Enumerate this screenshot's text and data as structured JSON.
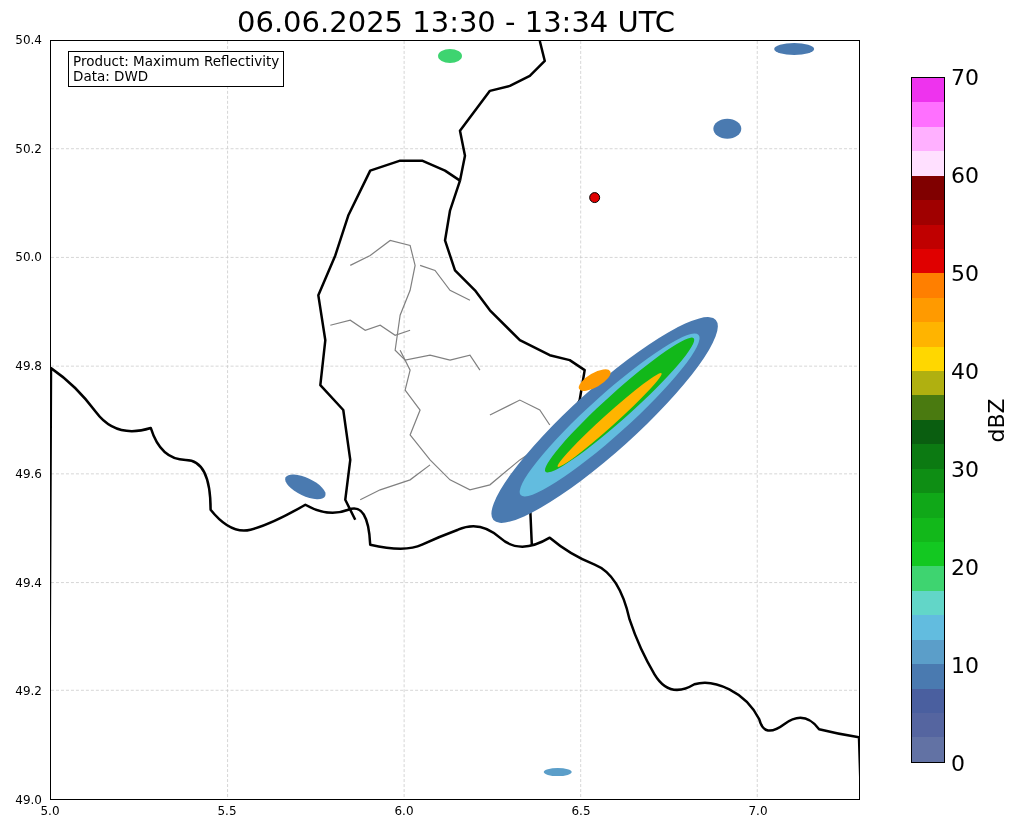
{
  "title": "06.06.2025 13:30 - 13:34 UTC",
  "map": {
    "legend": [
      "Product: Maximum Reflectivity",
      "Data: DWD"
    ],
    "x_ticks": [
      "5.0",
      "5.5",
      "6.0",
      "6.5",
      "7.0"
    ],
    "y_ticks": [
      "50.4",
      "50.2",
      "50.0",
      "49.8",
      "49.6",
      "49.4",
      "49.2",
      "49.0"
    ]
  },
  "colorbar": {
    "label": "dBZ",
    "ticks": [
      "70",
      "60",
      "50",
      "40",
      "30",
      "20",
      "10",
      "0"
    ],
    "segments": [
      {
        "color": "#6272a4"
      },
      {
        "color": "#5565a0"
      },
      {
        "color": "#4a5f9f"
      },
      {
        "color": "#4a7ab0"
      },
      {
        "color": "#5b9ec9"
      },
      {
        "color": "#62bcdf"
      },
      {
        "color": "#62d6c8"
      },
      {
        "color": "#3ed470"
      },
      {
        "color": "#13c821"
      },
      {
        "color": "#12b81a"
      },
      {
        "color": "#10a818"
      },
      {
        "color": "#0e8e14"
      },
      {
        "color": "#0c7a12"
      },
      {
        "color": "#0a5e10"
      },
      {
        "color": "#4a7a10"
      },
      {
        "color": "#b0b010"
      },
      {
        "color": "#ffd700"
      },
      {
        "color": "#ffb400"
      },
      {
        "color": "#ff9a00"
      },
      {
        "color": "#ff7f00"
      },
      {
        "color": "#e00000"
      },
      {
        "color": "#c00000"
      },
      {
        "color": "#a00000"
      },
      {
        "color": "#800000"
      },
      {
        "color": "#ffe0ff"
      },
      {
        "color": "#ffb0ff"
      },
      {
        "color": "#ff70ff"
      },
      {
        "color": "#ee33ee"
      }
    ]
  }
}
